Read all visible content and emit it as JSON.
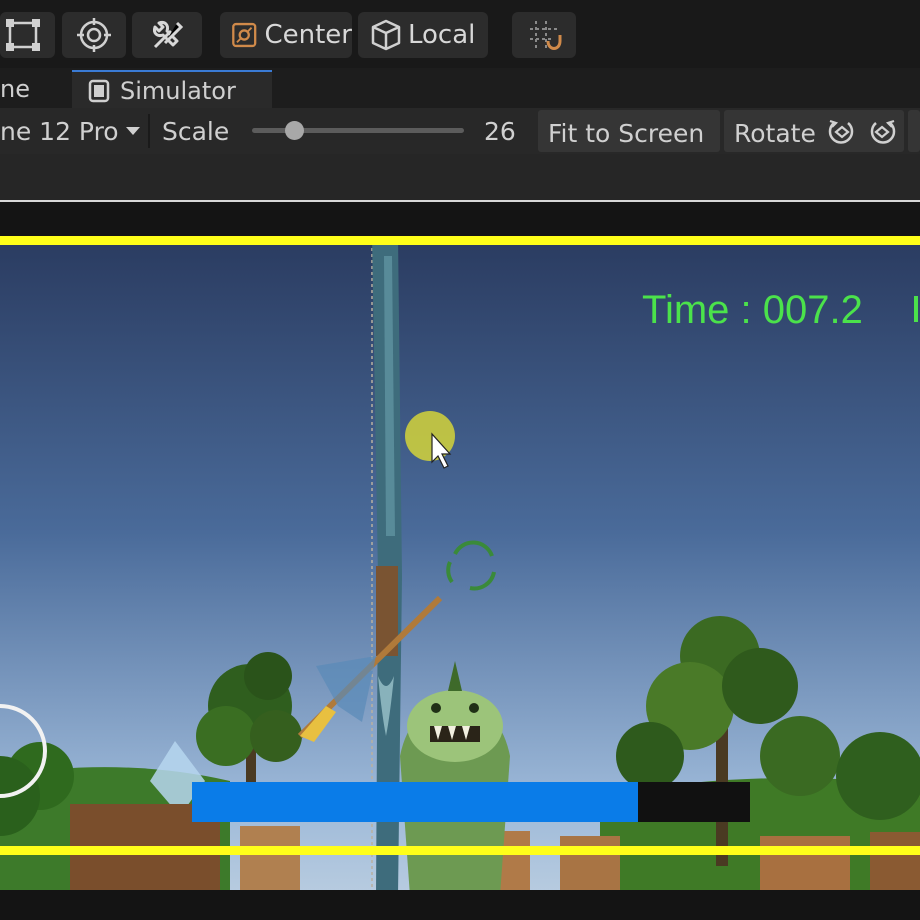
{
  "toolbar": {
    "pivot_label": "Center",
    "space_label": "Local"
  },
  "tabs": {
    "scene_label_partial": "ne",
    "simulator_label": "Simulator"
  },
  "simulator_controls": {
    "device_label_partial": "ne 12 Pro",
    "scale_label": "Scale",
    "scale_value": "26",
    "scale_fraction": 0.2,
    "fit_label": "Fit to Screen",
    "rotate_label": "Rotate"
  },
  "game_hud": {
    "time_text": "Time : 007.2",
    "health_fraction": 0.8,
    "colors": {
      "hud_text": "#4be24b",
      "safe_area": "#ffff1a",
      "health_fill": "#0a7ce8",
      "health_empty": "#111111"
    }
  }
}
